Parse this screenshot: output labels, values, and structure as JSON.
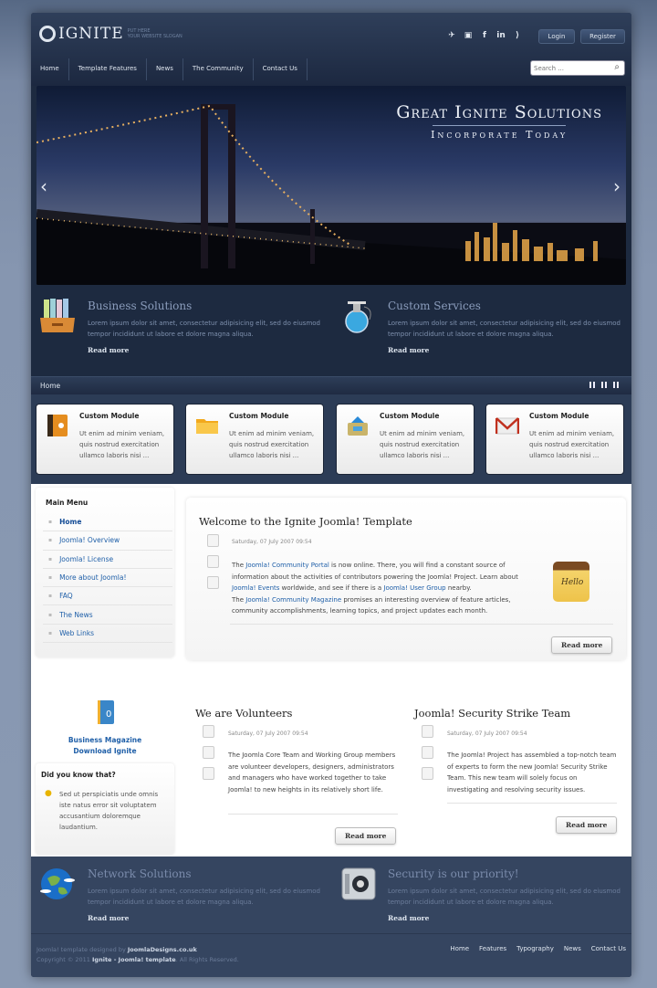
{
  "header": {
    "logo_text": "IGNITE",
    "slogan_line1": "PUT HERE",
    "slogan_line2": "YOUR WEBSITE SLOGAN",
    "social": [
      {
        "icon": "twitter-icon",
        "glyph": "✈"
      },
      {
        "icon": "youtube-icon",
        "glyph": "▣"
      },
      {
        "icon": "facebook-icon",
        "glyph": "f"
      },
      {
        "icon": "linkedin-icon",
        "glyph": "in"
      },
      {
        "icon": "rss-icon",
        "glyph": "⟩"
      }
    ],
    "login_label": "Login",
    "register_label": "Register",
    "nav": [
      "Home",
      "Template Features",
      "News",
      "The Community",
      "Contact Us"
    ],
    "search_placeholder": "Search ..."
  },
  "slider": {
    "title": "Great Ignite Solutions",
    "subtitle": "Incorporate Today",
    "prev": "‹",
    "next": "›"
  },
  "top_promos": [
    {
      "title": "Business Solutions",
      "text": "Lorem ipsum dolor sit amet, consectetur adipisicing elit, sed do eiusmod tempor incididunt ut labore et dolore magna aliqua.",
      "link": "Read more",
      "icon": "file-tray-icon"
    },
    {
      "title": "Custom Services",
      "text": "Lorem ipsum dolor sit amet, consectetur adipisicing elit, sed do eiusmod tempor incididunt ut labore et dolore magna aliqua.",
      "link": "Read more",
      "icon": "flask-icon"
    }
  ],
  "breadcrumb": "Home",
  "modules": [
    {
      "title": "Custom Module",
      "text": "Ut enim ad minim veniam, quis nostrud exercitation ullamco laboris nisi ...",
      "icon": "address-book-icon"
    },
    {
      "title": "Custom Module",
      "text": "Ut enim ad minim veniam, quis nostrud exercitation ullamco laboris nisi ...",
      "icon": "folder-icon"
    },
    {
      "title": "Custom Module",
      "text": "Ut enim ad minim veniam, quis nostrud exercitation ullamco laboris nisi ...",
      "icon": "inbox-icon"
    },
    {
      "title": "Custom Module",
      "text": "Ut enim ad minim veniam, quis nostrud exercitation ullamco laboris nisi ...",
      "icon": "mail-icon"
    }
  ],
  "main_menu": {
    "title": "Main Menu",
    "items": [
      "Home",
      "Joomla! Overview",
      "Joomla! License",
      "More about Joomla!",
      "FAQ",
      "The News",
      "Web Links"
    ]
  },
  "featured_article": {
    "title": "Welcome to the Ignite Joomla! Template",
    "date": "Saturday, 07 July 2007 09:54",
    "p1": "The ",
    "link1": "Joomla! Community Portal",
    "p2": " is now online. There, you will find a constant source of information about the activities of contributors powering the Joomla! Project. Learn about ",
    "link2": "Joomla! Events",
    "p3": " worldwide, and see if there is a ",
    "link3": "Joomla! User Group",
    "p4": " nearby.",
    "p5": "The ",
    "link4": "Joomla! Community Magazine",
    "p6": " promises an interesting overview of feature articles, community accomplishments, learning topics, and project updates each month.",
    "note_text": "Hello",
    "read_more": "Read more"
  },
  "sidebar_download": {
    "line1": "Business Magazine",
    "line2": "Download Ignite"
  },
  "did_you_know": {
    "title": "Did you know that?",
    "text": "Sed ut perspiciatis unde omnis iste natus error sit voluptatem accusantium doloremque laudantium."
  },
  "articles": [
    {
      "title": "We are Volunteers",
      "date": "Saturday, 07 July 2007 09:54",
      "text": "The Joomla Core Team and Working Group members are volunteer developers, designers, administrators and managers who have worked together to take Joomla! to new heights in its relatively short life.",
      "read_more": "Read more"
    },
    {
      "title": "Joomla! Security Strike Team",
      "date": "Saturday, 07 July 2007 09:54",
      "text": "The Joomla! Project has assembled a top-notch team of experts to form the new Joomla! Security Strike Team. This new team will solely focus on investigating and resolving security issues.",
      "read_more": "Read more"
    }
  ],
  "bottom_promos": [
    {
      "title": "Network Solutions",
      "text": "Lorem ipsum dolor sit amet, consectetur adipisicing elit, sed do eiusmod tempor incididunt ut labore et dolore magna aliqua.",
      "link": "Read more",
      "icon": "globe-icon"
    },
    {
      "title": "Security is our priority!",
      "text": "Lorem ipsum dolor sit amet, consectetur adipisicing elit, sed do eiusmod tempor incididunt ut labore et dolore magna aliqua.",
      "link": "Read more",
      "icon": "safe-icon"
    }
  ],
  "footer": {
    "designed_prefix": "Joomla! template designed by ",
    "designed_by": "JoomlaDesigns.co.uk",
    "copy_prefix": "Copyright © 2011 ",
    "copy_name": "Ignite - Joomla! template",
    "copy_suffix": ". All Rights Reserved.",
    "nav": [
      "Home",
      "Features",
      "Typography",
      "News",
      "Contact Us"
    ]
  }
}
